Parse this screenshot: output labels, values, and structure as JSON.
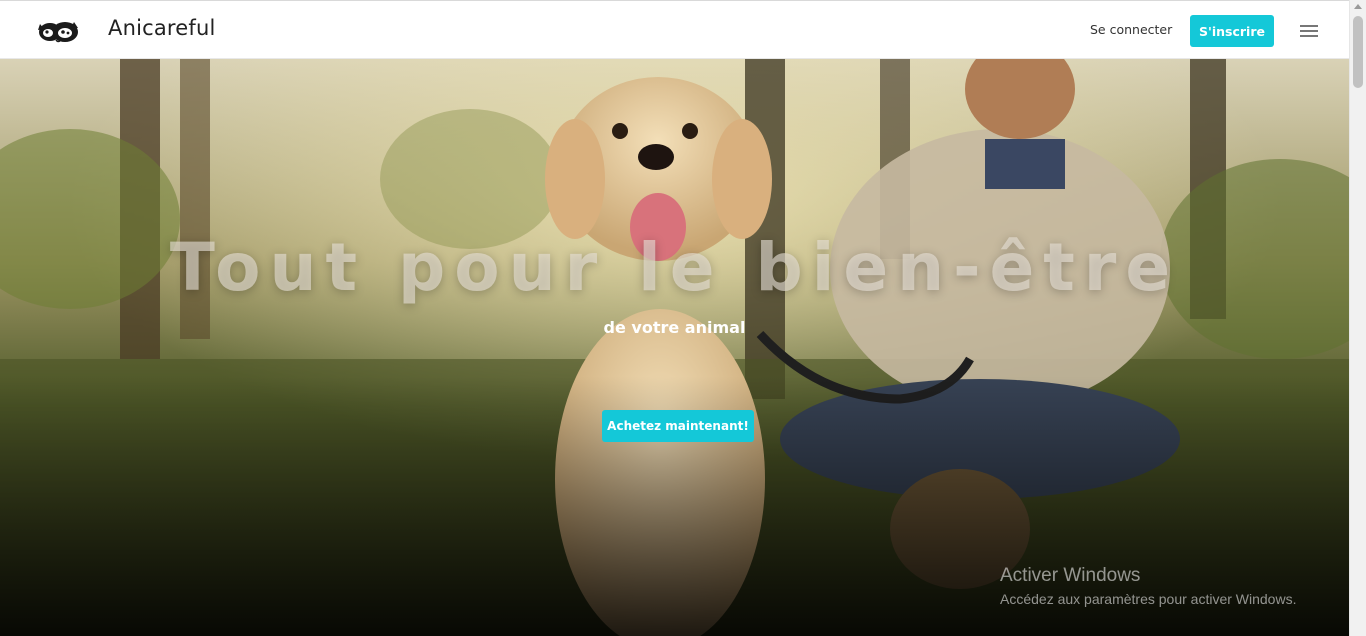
{
  "navbar": {
    "brand_name": "Anicareful",
    "login_label": "Se connecter",
    "signup_label": "S'inscrire",
    "logo_icon": "dog-cat-logo-icon",
    "menu_icon": "hamburger-menu-icon"
  },
  "hero": {
    "title": "Tout pour le bien-être",
    "subtitle": "de votre animal",
    "cta_label": "Achetez maintenant!"
  },
  "watermark": {
    "title": "Activer Windows",
    "text": "Accédez aux paramètres pour activer Windows."
  },
  "colors": {
    "accent": "#14c8d8",
    "navbar_bg": "#ffffff",
    "text_dark": "#222222"
  }
}
